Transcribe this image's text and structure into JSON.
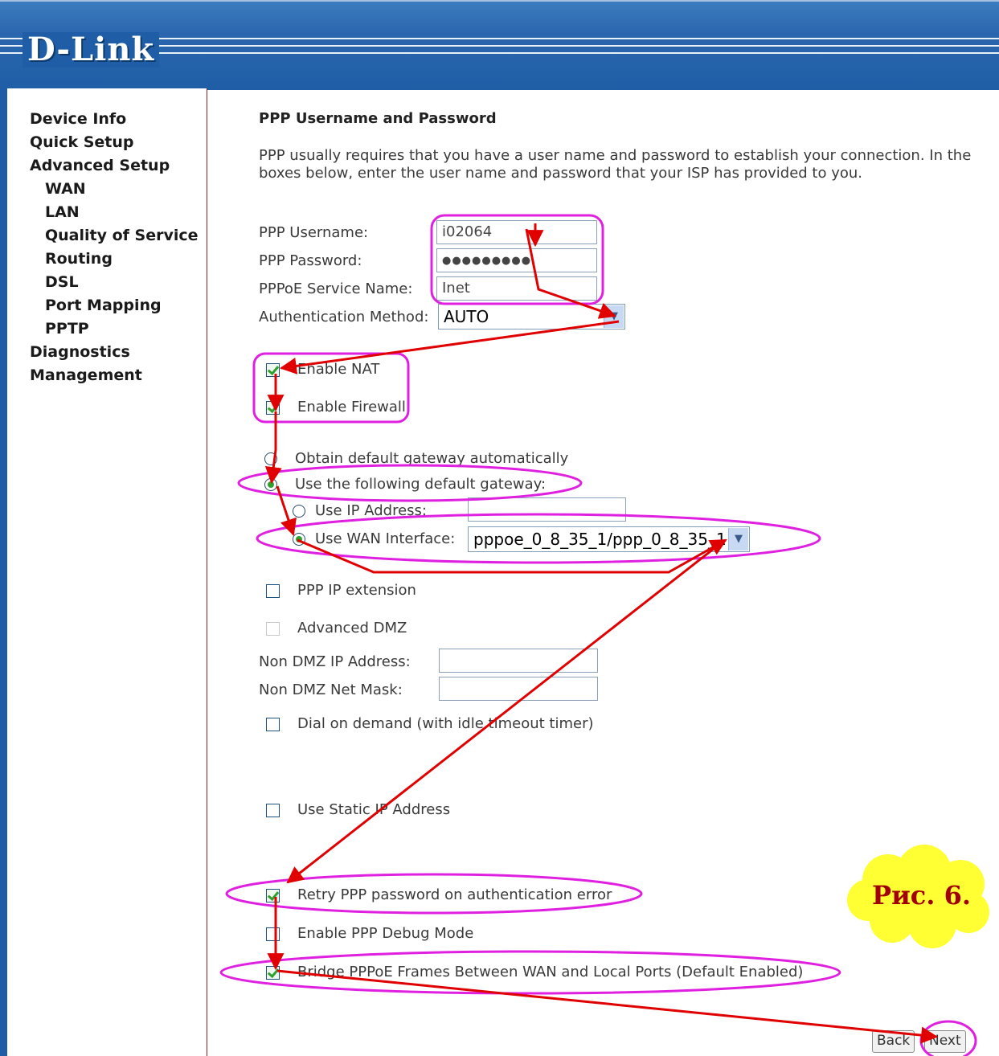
{
  "brand": {
    "logo_text": "D-Link"
  },
  "sidebar": {
    "items": [
      {
        "label": "Device Info"
      },
      {
        "label": "Quick Setup"
      },
      {
        "label": "Advanced Setup"
      },
      {
        "label": "WAN"
      },
      {
        "label": "LAN"
      },
      {
        "label": "Quality of Service"
      },
      {
        "label": "Routing"
      },
      {
        "label": "DSL"
      },
      {
        "label": "Port Mapping"
      },
      {
        "label": "PPTP"
      },
      {
        "label": "Diagnostics"
      },
      {
        "label": "Management"
      }
    ]
  },
  "main": {
    "title": "PPP Username and Password",
    "description_line1": "PPP usually requires that you have a user name and password to establish your connection. In the",
    "description_line2": "boxes below, enter the user name and password that your ISP has provided to you.",
    "fields": {
      "username_label": "PPP Username:",
      "username_value": "i02064",
      "password_label": "PPP Password:",
      "password_value": "●●●●●●●●●",
      "service_label": "PPPoE Service Name:",
      "service_value": "Inet",
      "auth_label": "Authentication Method:",
      "auth_value": "AUTO"
    },
    "options": {
      "enable_nat": "Enable NAT",
      "enable_nat_checked": true,
      "enable_firewall": "Enable Firewall",
      "enable_firewall_checked": true,
      "gateway_auto": "Obtain default gateway automatically",
      "gateway_manual": "Use the following default gateway:",
      "use_ip_address": "Use IP Address:",
      "use_wan_interface": "Use WAN Interface:",
      "wan_interface_value": "pppoe_0_8_35_1/ppp_0_8_35_1",
      "ppp_ip_extension": "PPP IP extension",
      "advanced_dmz": "Advanced DMZ",
      "non_dmz_ip": "Non DMZ IP Address:",
      "non_dmz_mask": "Non DMZ Net Mask:",
      "dial_on_demand": "Dial on demand (with idle timeout timer)",
      "use_static_ip": "Use Static IP Address",
      "retry_ppp": "Retry PPP password on authentication error",
      "ppp_debug": "Enable PPP Debug Mode",
      "bridge_pppoe": "Bridge PPPoE Frames Between WAN and Local Ports (Default Enabled)"
    },
    "buttons": {
      "back": "Back",
      "next": "Next"
    }
  },
  "annotation": {
    "figure_label": "Рис. 6.",
    "highlight_color": "#e020e0",
    "arrow_color": "#e00000",
    "cloud_color": "#ffff33"
  }
}
